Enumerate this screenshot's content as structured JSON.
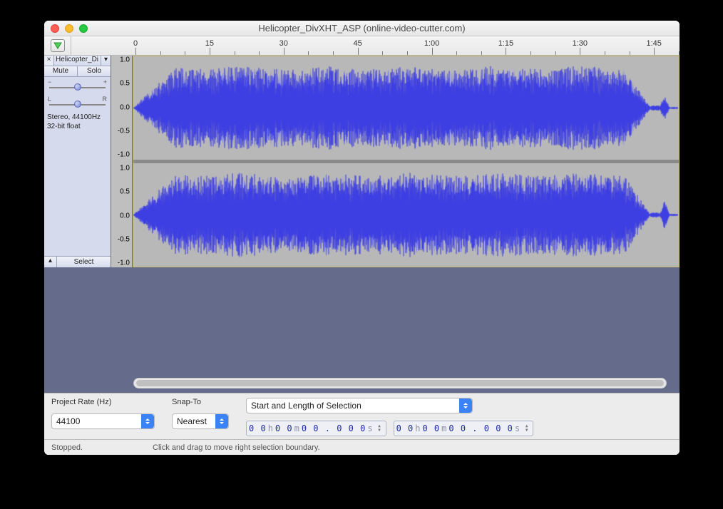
{
  "window": {
    "title": "Helicopter_DivXHT_ASP (online-video-cutter.com)"
  },
  "ruler": {
    "ticks": [
      {
        "t": 0,
        "label": "0"
      },
      {
        "t": 15,
        "label": "15"
      },
      {
        "t": 30,
        "label": "30"
      },
      {
        "t": 45,
        "label": "45"
      },
      {
        "t": 60,
        "label": "1:00"
      },
      {
        "t": 75,
        "label": "1:15"
      },
      {
        "t": 90,
        "label": "1:30"
      },
      {
        "t": 105,
        "label": "1:45"
      }
    ],
    "duration_seconds": 108
  },
  "track": {
    "name": "Helicopter_Di",
    "mute_label": "Mute",
    "solo_label": "Solo",
    "gain": {
      "left_label": "−",
      "right_label": "+",
      "value": 0.5
    },
    "pan": {
      "left_label": "L",
      "right_label": "R",
      "value": 0.5
    },
    "info_line1": "Stereo, 44100Hz",
    "info_line2": "32-bit float",
    "select_label": "Select",
    "vscale_labels": [
      "1.0",
      "0.5",
      "0.0",
      "-0.5",
      "-1.0"
    ]
  },
  "bottom": {
    "project_rate_label": "Project Rate (Hz)",
    "project_rate_value": "44100",
    "snap_to_label": "Snap-To",
    "snap_to_value": "Nearest",
    "selection_mode_label": "Start and Length of Selection",
    "time1": {
      "h": "0 0",
      "m": "0 0",
      "s": "0 0 . 0 0 0"
    },
    "time2": {
      "h": "0 0",
      "m": "0 0",
      "s": "0 0 . 0 0 0"
    }
  },
  "status": {
    "state": "Stopped.",
    "hint": "Click and drag to move right selection boundary."
  },
  "colors": {
    "wave_outline": "#2f2fe0",
    "wave_fill": "#6f74e6"
  }
}
